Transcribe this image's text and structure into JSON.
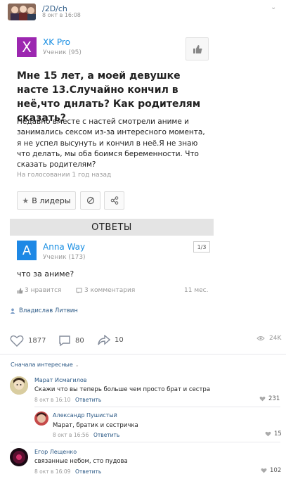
{
  "post": {
    "group_name": "/2D/ch",
    "date": "8 окт в 16:08",
    "menu_glyph": "⌄"
  },
  "question": {
    "author_initial": "X",
    "author_name": "XK Pro",
    "author_rank": "Ученик (95)",
    "title": "Мне 15 лет, а моей девушке насте 13.Случайно кончил в неё,что днлать? Как родителям сказать?",
    "body": "Недавно вместе с настей смотрели аниме и занимались сексом из-за интересного момента, я не успел высунуть и кончил в неё.Я не знаю что делать, мы оба боимся беременности. Что сказать родителям?",
    "meta": "На голосовании 1 год назад",
    "leaders_button": "В лидеры",
    "answers_label": "ОТВЕТЫ"
  },
  "answer": {
    "author_initial": "A",
    "author_name": "Anna Way",
    "author_rank": "Ученик (173)",
    "page": "1/3",
    "text": "что за аниме?",
    "likes": "3 нравится",
    "comments": "3 комментария",
    "age": "11 мес."
  },
  "post_author": "Владислав Литвин",
  "post_stats": {
    "likes": "1877",
    "comments": "80",
    "shares": "10",
    "views": "24K"
  },
  "comments_sort": "Сначала интересные",
  "comments": [
    {
      "name": "Марат Исмагилов",
      "text": "Скажи что вы теперь больше чем просто брат и сестра",
      "date": "8 окт в 16:10",
      "reply": "Ответить",
      "likes": "231"
    },
    {
      "name": "Александр Пушистый",
      "text": "Марат, братик и сестричка",
      "date": "8 окт в 16:56",
      "reply": "Ответить",
      "likes": "15"
    },
    {
      "name": "Егор Лещенко",
      "text": "связанные небом, сто пудова",
      "date": "8 окт в 16:09",
      "reply": "Ответить",
      "likes": "102"
    }
  ],
  "colors": {
    "vk_link": "#2a5885",
    "answers_blue": "#168de2",
    "xk_avatar": "#9c27b0",
    "anna_avatar": "#1e88e5"
  }
}
